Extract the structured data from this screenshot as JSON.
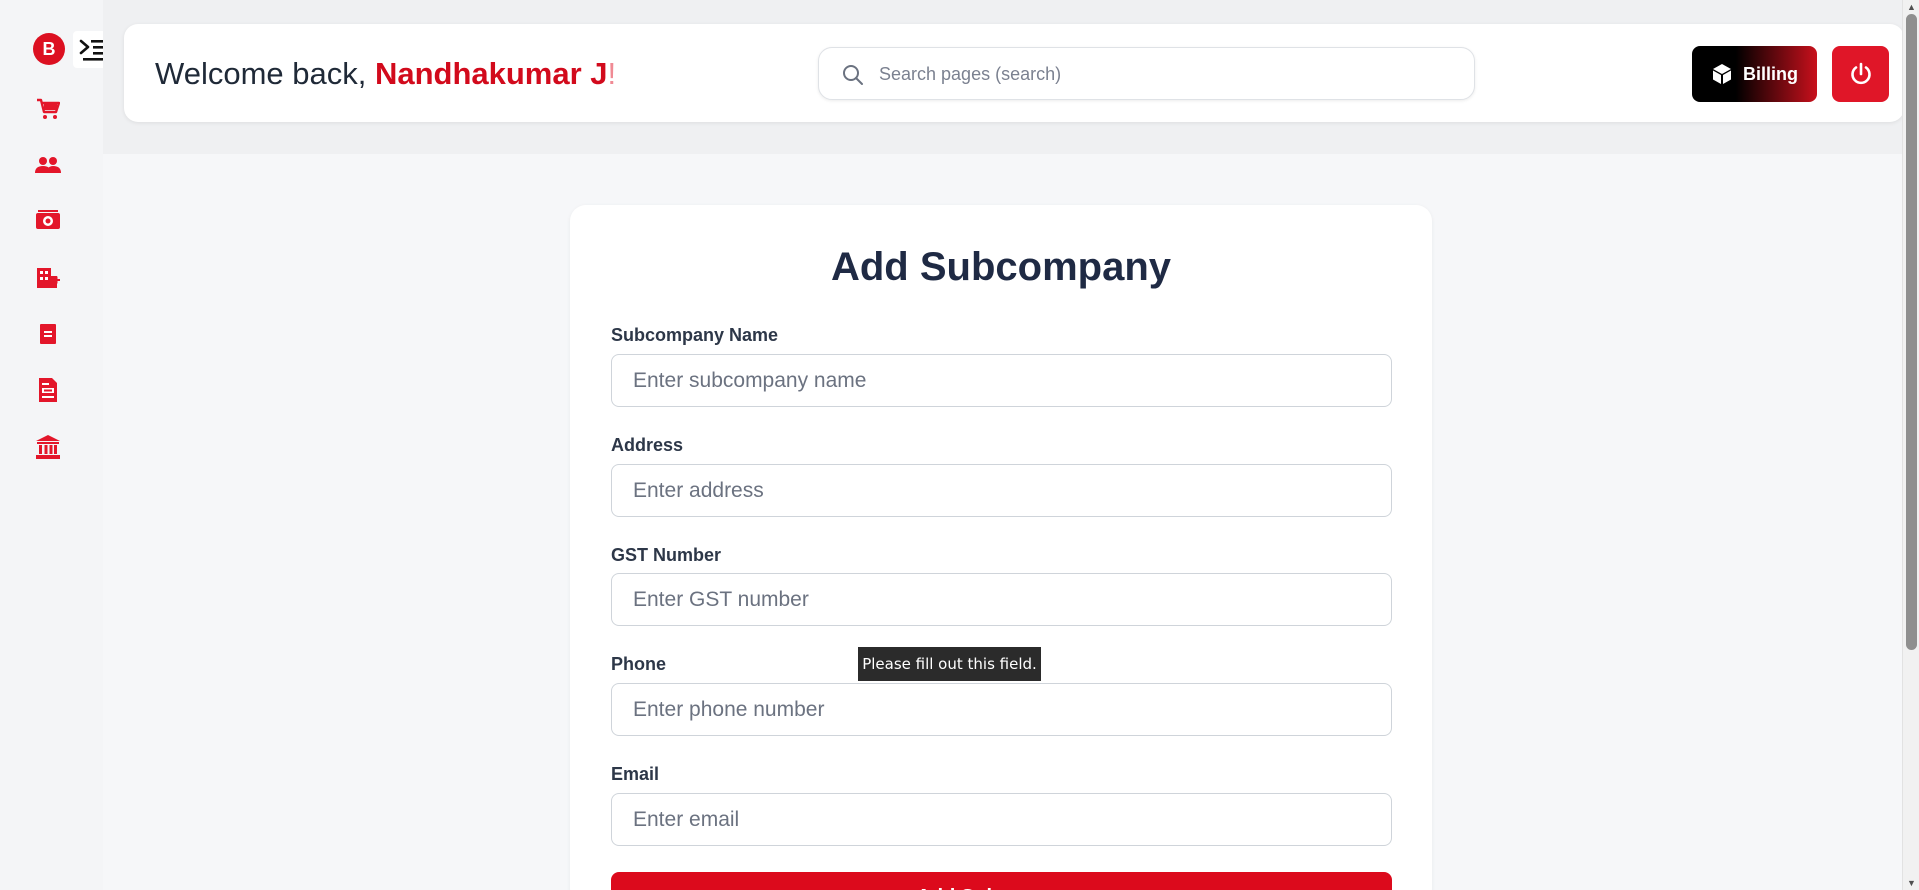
{
  "sidebar": {
    "logo_letter": "B",
    "items": [
      {
        "icon": "cart-icon"
      },
      {
        "icon": "users-icon"
      },
      {
        "icon": "money-icon"
      },
      {
        "icon": "building-add-icon"
      },
      {
        "icon": "receipt-icon"
      },
      {
        "icon": "invoice-icon"
      },
      {
        "icon": "bank-icon"
      }
    ]
  },
  "header": {
    "welcome_prefix": "Welcome back, ",
    "user_name": "Nandhakumar J",
    "welcome_suffix": "!",
    "search_placeholder": "Search pages (search)",
    "billing_label": "Billing"
  },
  "form": {
    "title": "Add Subcompany",
    "fields": [
      {
        "label": "Subcompany Name",
        "placeholder": "Enter subcompany name",
        "value": ""
      },
      {
        "label": "Address",
        "placeholder": "Enter address",
        "value": ""
      },
      {
        "label": "GST Number",
        "placeholder": "Enter GST number",
        "value": ""
      },
      {
        "label": "Phone",
        "placeholder": "Enter phone number",
        "value": ""
      },
      {
        "label": "Email",
        "placeholder": "Enter email",
        "value": ""
      }
    ],
    "submit_label": "Add Subcompany",
    "validation_tooltip": "Please fill out this field."
  },
  "colors": {
    "accent": "#dc0a1c",
    "dark": "#000000"
  }
}
